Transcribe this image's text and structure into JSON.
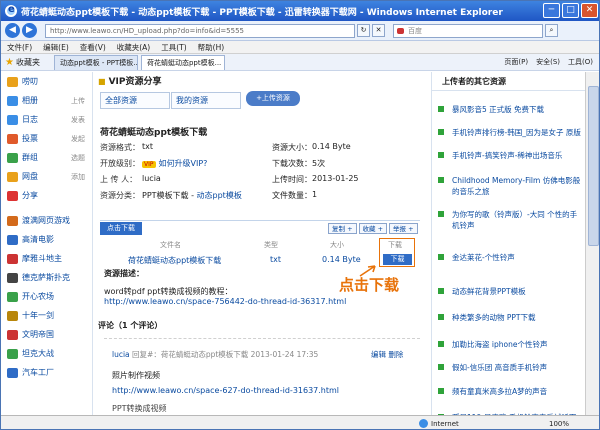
{
  "window": {
    "title": "荷花蜻蜓动态ppt模板下载 - 动态ppt模板下载 - PPT模板下载 - 迅雷转换器下载网 - Windows Internet Explorer",
    "min": "─",
    "max": "□",
    "close": "✕"
  },
  "address": {
    "url": "http://www.leawo.cn/HD_upload.php?do=info&id=5555",
    "search_placeholder": "百度"
  },
  "menu": [
    "文件(F)",
    "编辑(E)",
    "查看(V)",
    "收藏夹(A)",
    "工具(T)",
    "帮助(H)"
  ],
  "favbar": {
    "label": "收藏夹",
    "tabs": [
      "动态ppt模板 - PPT模板...",
      "荷花蜻蜓动态ppt模板..."
    ]
  },
  "tools": [
    "页面(P)",
    "安全(S)",
    "工具(O)"
  ],
  "left_nav": {
    "items": [
      {
        "label": "唠叨",
        "sub": "",
        "color": "#e9a11b"
      },
      {
        "label": "相册",
        "sub": "上传",
        "color": "#3a8ee6"
      },
      {
        "label": "日志",
        "sub": "发表",
        "color": "#3a8ee6"
      },
      {
        "label": "投票",
        "sub": "发起",
        "color": "#e05a2b"
      },
      {
        "label": "群组",
        "sub": "选题",
        "color": "#3aa14a"
      },
      {
        "label": "网盘",
        "sub": "添加",
        "color": "#e9a11b"
      },
      {
        "label": "分享",
        "sub": "",
        "color": "#d33"
      }
    ],
    "games": [
      {
        "label": "渡满网页游戏",
        "color": "#d36a1b"
      },
      {
        "label": "高清电影",
        "color": "#2f6cc6"
      },
      {
        "label": "摩雅斗地主",
        "color": "#c33"
      },
      {
        "label": "德克萨斯扑克",
        "color": "#444"
      },
      {
        "label": "开心农场",
        "color": "#3aa14a"
      },
      {
        "label": "十年一剑",
        "color": "#b8860b"
      },
      {
        "label": "文明帝国",
        "color": "#c33"
      },
      {
        "label": "坦克大战",
        "color": "#3aa14a"
      },
      {
        "label": "汽车工厂",
        "color": "#2f6cc6"
      }
    ]
  },
  "main": {
    "section_title": "VIP资源分享",
    "tabs": [
      "全部资源",
      "我的资源"
    ],
    "upload_button": "+上传资源",
    "file_title": "荷花蜻蜓动态ppt模板下载",
    "info": {
      "format_label": "资源格式：",
      "format": "txt",
      "size_label": "资源大小：",
      "size": "0.14 Byte",
      "level_label": "开放级别：",
      "vip": "VIP",
      "upgrade": "如何升级VIP?",
      "downloads_label": "下载次数：",
      "downloads": "5次",
      "uploader_label": "上 传 人：",
      "uploader": "lucia",
      "upload_time_label": "上传时间：",
      "upload_time": "2013-01-25",
      "category_label": "资源分类：",
      "category_a": "PPT模板下载",
      "category_sep": " - ",
      "category_b": "动态ppt模板",
      "filecount_label": "文件数量：",
      "filecount": "1"
    },
    "download_button": "点击下载",
    "actions": [
      "复制 +",
      "收藏 +",
      "举报 +"
    ],
    "table": {
      "headers": [
        "文件名",
        "类型",
        "大小",
        "下载"
      ],
      "row": {
        "name": "荷花蜻蜓动态ppt模板下载",
        "type": "txt",
        "size": "0.14 Byte",
        "button": "下载"
      }
    },
    "callout": "点击下载",
    "desc_label": "资源描述：",
    "tutorial_text": "word转pdf ppt转换成视频的教程：",
    "tutorial_link": "http://www.leawo.cn/space-756442-do-thread-id-36317.html",
    "comments_label": "评论（1 个评论）",
    "comment": {
      "user": "lucia",
      "meta": "回复#：荷花蜻蜓动态ppt模板下载 2013-01-24 17:35",
      "edit": "编辑",
      "delete": "删除",
      "text": "照片制作视频",
      "link": "http://www.leawo.cn/space-627-do-thread-id-31637.html",
      "text2": "PPT转换成视频"
    }
  },
  "right": {
    "title": "上传者的其它资源",
    "items": [
      "暴风影音5 正式版 免费下载",
      "手机铃声排行榜-韩国_因为是女子 原版",
      "手机铃声-搞笑铃声-稀神出场音乐",
      "Childhood Memory-Film 仿佛电影般的音乐之旅",
      "为你写的歌（铃声版）-大同 个性的手机铃声",
      "金达莱花-个性铃声",
      "动态鲜花背景PPT模板",
      "种类繁多的动物 PPT下载",
      "加勒比海盗 iphone个性铃声",
      "假如-信乐团 高音质手机铃声",
      "频有童真米高多拉A梦的声音",
      "孤星119-吴奇隆 手机铃声音乐试听下载"
    ]
  },
  "status": {
    "zone": "Internet",
    "zoom": "100%"
  }
}
